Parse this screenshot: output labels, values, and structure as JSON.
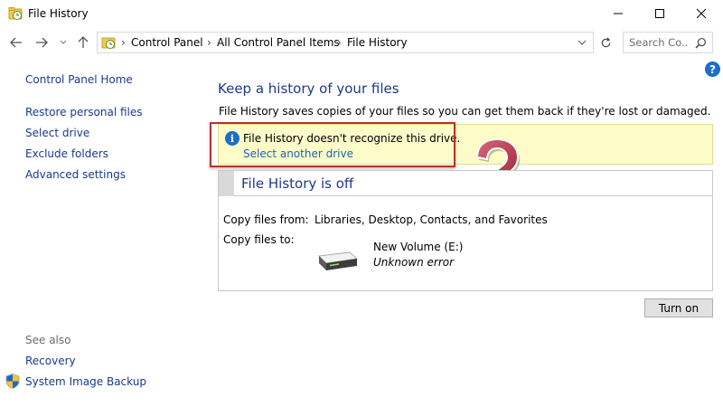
{
  "window": {
    "title": "File History",
    "icon": "file-history-icon",
    "controls": {
      "minimize": "minimize-icon",
      "maximize": "maximize-icon",
      "close": "close-icon"
    }
  },
  "navigation": {
    "breadcrumb": [
      "Control Panel",
      "All Control Panel Items",
      "File History"
    ],
    "search_placeholder": "Search Co..."
  },
  "sidebar": {
    "home": "Control Panel Home",
    "links": [
      "Restore personal files",
      "Select drive",
      "Exclude folders",
      "Advanced settings"
    ],
    "see_also_label": "See also",
    "see_also_links": [
      "Recovery",
      "System Image Backup"
    ]
  },
  "main": {
    "title": "Keep a history of your files",
    "description": "File History saves copies of your files so you can get them back if they're lost or damaged.",
    "notice": {
      "message": "File History doesn't recognize this drive.",
      "link": "Select another drive"
    },
    "status": {
      "title": "File History is off",
      "copy_from_label": "Copy files from:",
      "copy_from_value": "Libraries, Desktop, Contacts, and Favorites",
      "copy_to_label": "Copy files to:",
      "drive_name": "New Volume (E:)",
      "drive_status": "Unknown error"
    },
    "turn_on_label": "Turn on"
  },
  "colors": {
    "link": "#1a3a8a",
    "heading": "#1e3a8a",
    "notice_bg": "#fdfbc8",
    "highlight": "#b7322b",
    "question_mark": "#b3364a"
  }
}
